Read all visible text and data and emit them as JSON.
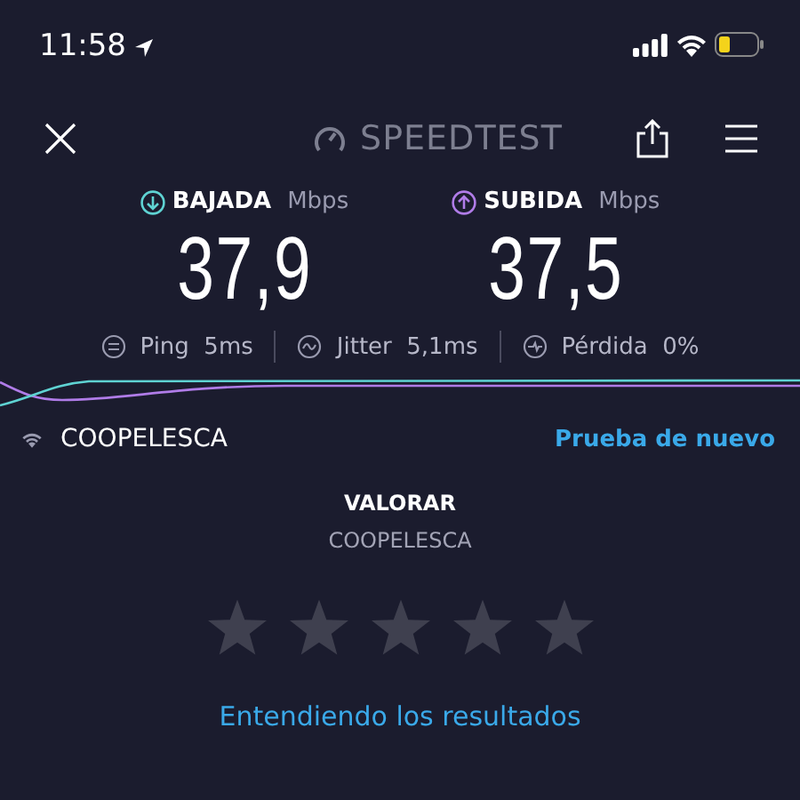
{
  "status_bar": {
    "time": "11:58"
  },
  "header": {
    "title": "SPEEDTEST"
  },
  "metrics": [
    {
      "kind": "download",
      "label": "BAJADA",
      "unit": "Mbps",
      "value": "37,9",
      "color": "#5fd3d3"
    },
    {
      "kind": "upload",
      "label": "SUBIDA",
      "unit": "Mbps",
      "value": "37,5",
      "color": "#b07ce8"
    }
  ],
  "stats": [
    {
      "kind": "ping",
      "label": "Ping",
      "value": "5ms"
    },
    {
      "kind": "jitter",
      "label": "Jitter",
      "value": "5,1ms"
    },
    {
      "kind": "loss",
      "label": "Pérdida",
      "value": "0%"
    }
  ],
  "network": {
    "name": "COOPELESCA",
    "action": "Prueba de nuevo"
  },
  "rating": {
    "title": "VALORAR",
    "provider": "COOPELESCA",
    "stars": 0
  },
  "link": "Entendiendo los resultados"
}
